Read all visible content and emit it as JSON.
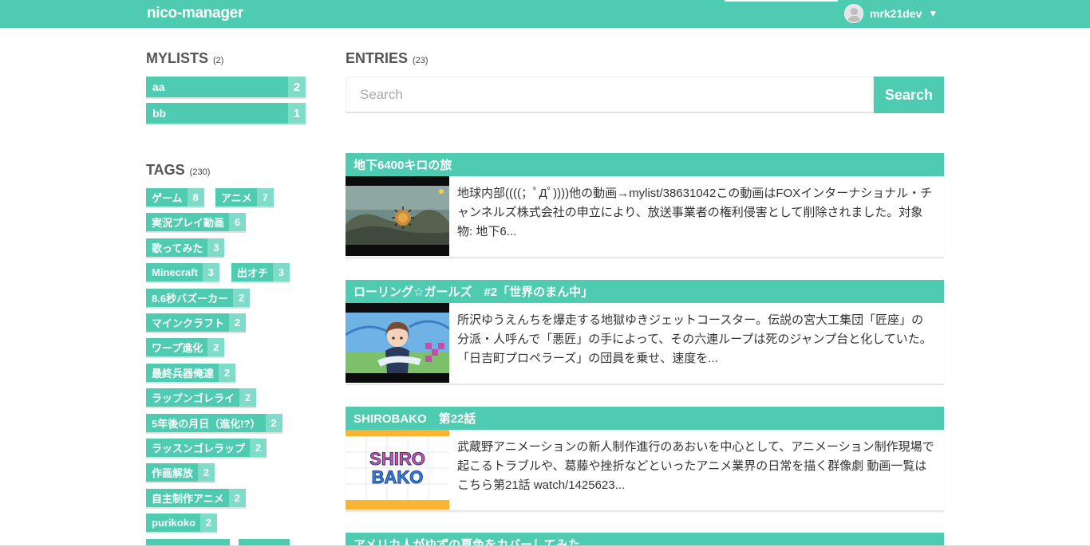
{
  "app": {
    "brand": "nico-manager"
  },
  "user": {
    "name": "mrk21dev",
    "caret": "▼",
    "avatar_icon": "avatar-icon"
  },
  "mylists": {
    "title": "MYLISTS",
    "count": "(2)",
    "items": [
      {
        "label": "aa",
        "count": "2"
      },
      {
        "label": "bb",
        "count": "1"
      }
    ]
  },
  "tags": {
    "title": "TAGS",
    "count": "(230)",
    "items": [
      {
        "label": "ゲーム",
        "count": "8"
      },
      {
        "label": "アニメ",
        "count": "7"
      },
      {
        "label": "実況プレイ動画",
        "count": "6"
      },
      {
        "label": "歌ってみた",
        "count": "3"
      },
      {
        "label": "Minecraft",
        "count": "3"
      },
      {
        "label": "出オチ",
        "count": "3"
      },
      {
        "label": "8.6秒バズーカー",
        "count": "2"
      },
      {
        "label": "マインクラフト",
        "count": "2"
      },
      {
        "label": "ワープ進化",
        "count": "2"
      },
      {
        "label": "最終兵器俺達",
        "count": "2"
      },
      {
        "label": "ラップンゴレライ",
        "count": "2"
      },
      {
        "label": "5年後の月日（進化!?）",
        "count": "2"
      },
      {
        "label": "ラッスンゴレラップ",
        "count": "2"
      },
      {
        "label": "作画解放",
        "count": "2"
      },
      {
        "label": "自主制作アニメ",
        "count": "2"
      },
      {
        "label": "purikoko",
        "count": "2"
      }
    ]
  },
  "entries": {
    "title": "ENTRIES",
    "count": "(23)",
    "search": {
      "placeholder": "Search",
      "value": "",
      "button_label": "Search"
    },
    "items": [
      {
        "title": "地下6400キロの旅",
        "description": "地球内部((((；ﾟДﾟ))))他の動画→mylist/38631042この動画はFOXインターナショナル・チャンネルズ株式会社の申立により、放送事業者の権利侵害として削除されました。対象物: 地下6..."
      },
      {
        "title": "ローリング☆ガールズ　#2「世界のまん中」",
        "description": "所沢ゆうえんちを爆走する地獄ゆきジェットコースター。伝説の宮大工集団「匠座」の分派・人呼んで「悪匠」の手によって、その六連ループは死のジャンプ台と化していた。「日吉町プロペラーズ」の団員を乗せ、速度を..."
      },
      {
        "title": "SHIROBAKO　第22話",
        "description": "武蔵野アニメーションの新人制作進行のあおいを中心として、アニメーション制作現場で起こるトラブルや、葛藤や挫折などといったアニメ業界の日常を描く群像劇 動画一覧はこちら第21話 watch/1425623...",
        "thumb_logo_line1": "SHIRO",
        "thumb_logo_line2": "BAKO"
      },
      {
        "title": "アメリカ人がゆずの夏色をカバーしてみた"
      }
    ]
  },
  "colors": {
    "accent": "#4ecbb1",
    "accent_light": "#7fdcc8",
    "text": "#333333"
  }
}
